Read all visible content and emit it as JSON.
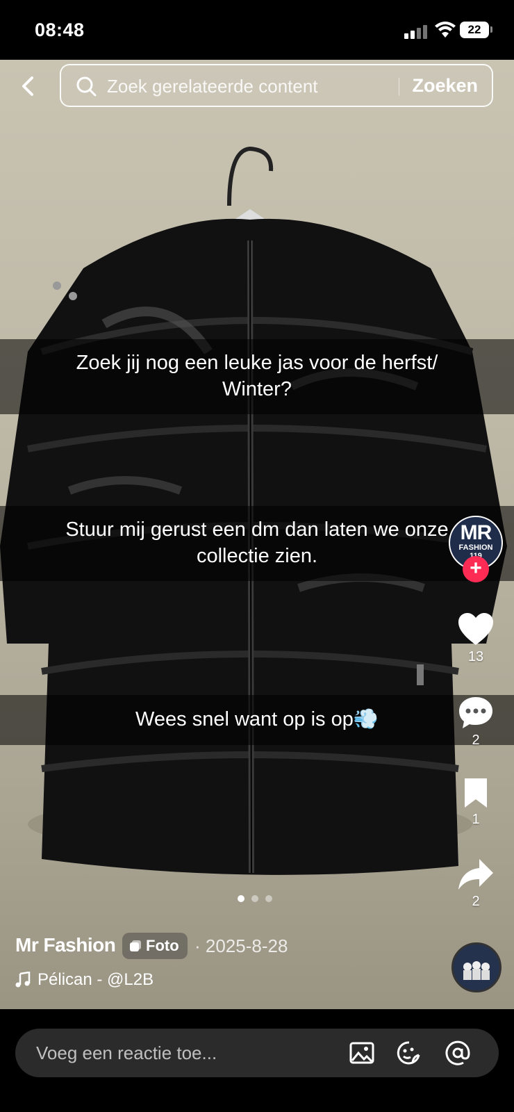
{
  "status_bar": {
    "time": "08:48",
    "battery": "22"
  },
  "search": {
    "placeholder": "Zoek gerelateerde content",
    "submit_label": "Zoeken"
  },
  "captions": [
    {
      "line1": "Zoek jij nog een leuke jas voor de herfst/",
      "line2": "Winter?"
    },
    {
      "line1": "Stuur mij gerust een dm dan laten we onze",
      "line2": "collectie zien."
    },
    {
      "line1": "Wees snel want op is op💨"
    }
  ],
  "profile": {
    "avatar_text": "MR",
    "avatar_subtext": "FASHION",
    "avatar_number": "119"
  },
  "actions": {
    "likes": "13",
    "comments": "2",
    "saves": "1",
    "shares": "2"
  },
  "carousel": {
    "count": 3,
    "active_index": 0
  },
  "post": {
    "author": "Mr Fashion",
    "badge_label": "Foto",
    "date": "· 2025-8-28",
    "music": "Pélican - @L2B"
  },
  "comment": {
    "placeholder": "Voeg een reactie toe..."
  },
  "icons": [
    "back-icon",
    "search-icon",
    "heart-icon",
    "comment-icon",
    "bookmark-icon",
    "share-icon",
    "music-note-icon",
    "image-icon",
    "emoji-icon",
    "mention-icon",
    "photo-badge-icon"
  ],
  "colors": {
    "accent": "#fe2c55",
    "background": "#000000",
    "comment_box": "#2b2b2b"
  }
}
